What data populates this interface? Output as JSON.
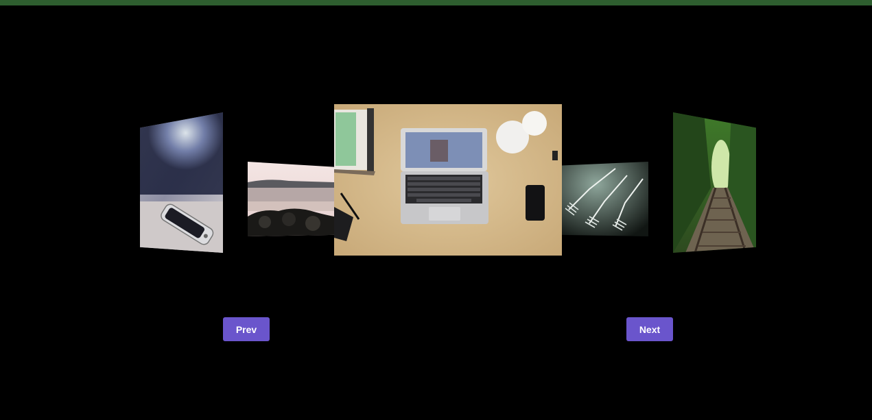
{
  "carousel": {
    "slides": [
      {
        "name": "phone-on-table",
        "position": "far-left"
      },
      {
        "name": "rocky-beach",
        "position": "left"
      },
      {
        "name": "laptop-on-desk",
        "position": "center"
      },
      {
        "name": "forks",
        "position": "right"
      },
      {
        "name": "railway-track-forest",
        "position": "far-right"
      }
    ],
    "active_slide": "laptop-on-desk"
  },
  "controls": {
    "prev_label": "Prev",
    "next_label": "Next"
  },
  "colors": {
    "top_bar": "#2e5e2f",
    "background": "#000000",
    "button": "#6a55cc",
    "button_text": "#ffffff"
  }
}
